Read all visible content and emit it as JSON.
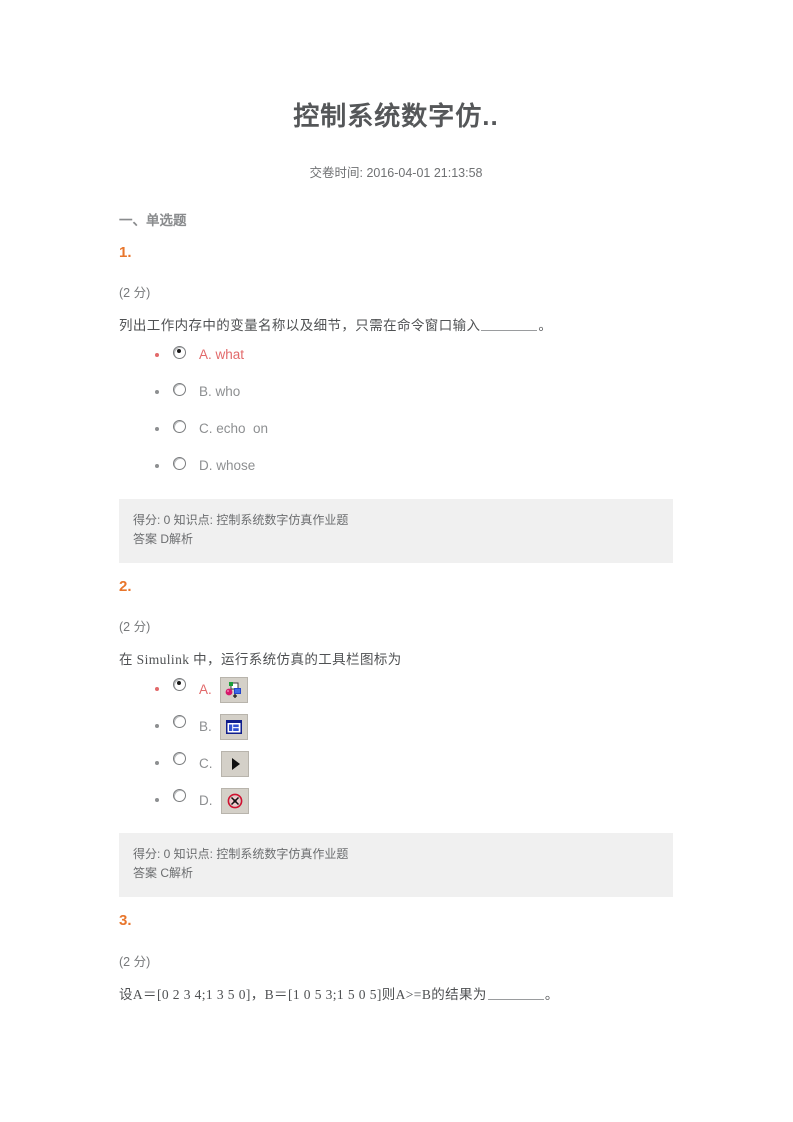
{
  "document": {
    "title": "控制系统数字仿..",
    "submit_label": "交卷时间:",
    "submit_time": "2016-04-01 21:13:58",
    "section_title": "一、单选题",
    "accent_color": "#e8762c",
    "selected_color": "#e2696a",
    "answer_box_bg": "#f0f0f0"
  },
  "questions": [
    {
      "number": "1.",
      "score": "(2 分)",
      "stem_before": "列出工作内存中的变量名称以及细节，只需在命令窗口输入",
      "stem_after": "。",
      "options": [
        {
          "text": "A. what",
          "selected": true,
          "checked": true
        },
        {
          "text": "B. who",
          "selected": false,
          "checked": false
        },
        {
          "text": "C. echo  on",
          "selected": false,
          "checked": false
        },
        {
          "text": "D. whose",
          "selected": false,
          "checked": false
        }
      ],
      "answer_line1": "得分: 0 知识点: 控制系统数字仿真作业题",
      "answer_line2": "答案 D解析"
    },
    {
      "number": "2.",
      "score": "(2 分)",
      "stem_before": "在 Simulink 中，运行系统仿真的工具栏图标为",
      "stem_after": "",
      "options": [
        {
          "text": "A.",
          "selected": true,
          "checked": true,
          "icon": "simulink-new-model-icon"
        },
        {
          "text": "B.",
          "selected": false,
          "checked": false,
          "icon": "simulink-library-browser-icon"
        },
        {
          "text": "C.",
          "selected": false,
          "checked": false,
          "icon": "simulink-run-play-icon"
        },
        {
          "text": "D.",
          "selected": false,
          "checked": false,
          "icon": "simulink-stop-icon"
        }
      ],
      "answer_line1": "得分: 0 知识点: 控制系统数字仿真作业题",
      "answer_line2": "答案 C解析"
    },
    {
      "number": "3.",
      "score": "(2 分)",
      "stem_before": "设A＝[0 2 3 4;1 3 5 0]，B＝[1 0 5 3;1 5 0 5]则A>=B的结果为",
      "stem_after": "。",
      "options": [],
      "answer_line1": "",
      "answer_line2": ""
    }
  ]
}
